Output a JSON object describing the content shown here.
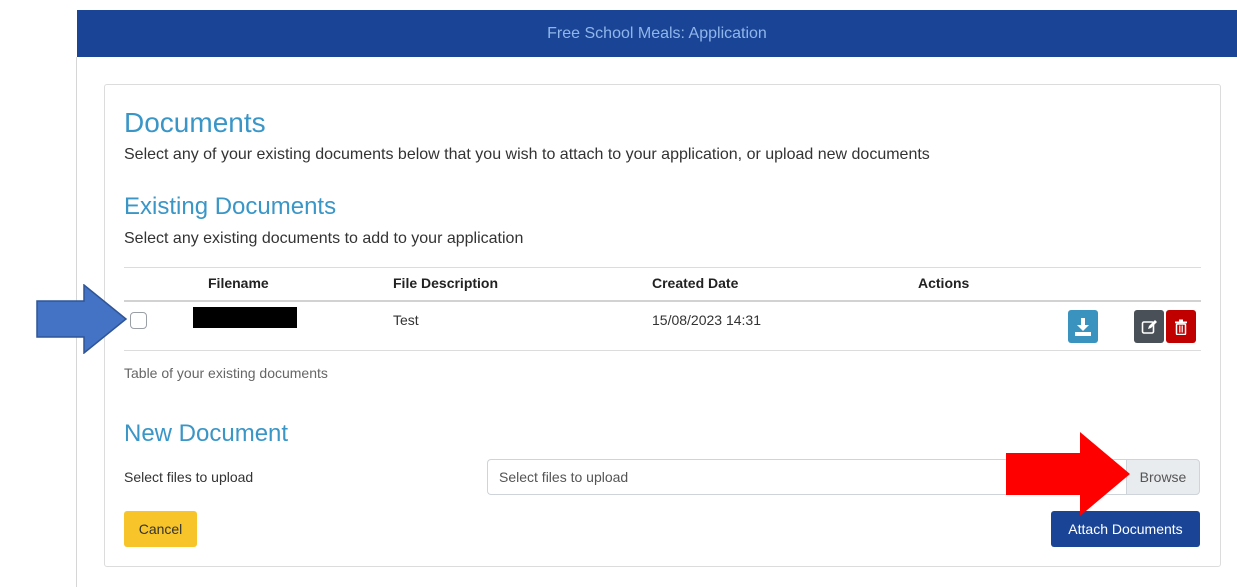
{
  "header": {
    "title": "Free School Meals: Application"
  },
  "documents": {
    "title": "Documents",
    "description": "Select any of your existing documents below that you wish to attach to your application, or upload new documents"
  },
  "existing": {
    "title": "Existing Documents",
    "description": "Select any existing documents to add to your application",
    "columns": [
      "Filename",
      "File Description",
      "Created Date",
      "Actions"
    ],
    "rows": [
      {
        "filename": "",
        "description": "Test",
        "created": "15/08/2023 14:31",
        "selected": false
      }
    ],
    "caption": "Table of your existing documents",
    "actions": {
      "download_icon": "download-icon",
      "edit_icon": "edit-icon",
      "delete_icon": "trash-icon"
    }
  },
  "new_document": {
    "title": "New Document",
    "label": "Select files to upload",
    "placeholder": "Select files to upload",
    "browse_label": "Browse"
  },
  "buttons": {
    "cancel": "Cancel",
    "attach": "Attach Documents"
  },
  "colors": {
    "header_bg": "#1a4597",
    "heading": "#3a96c7",
    "download_btn": "#3a93bf",
    "edit_btn": "#495057",
    "delete_btn": "#c00000",
    "cancel_btn": "#f7c52a",
    "annotation_blue": "#4472c4",
    "annotation_red": "#ff0000"
  }
}
